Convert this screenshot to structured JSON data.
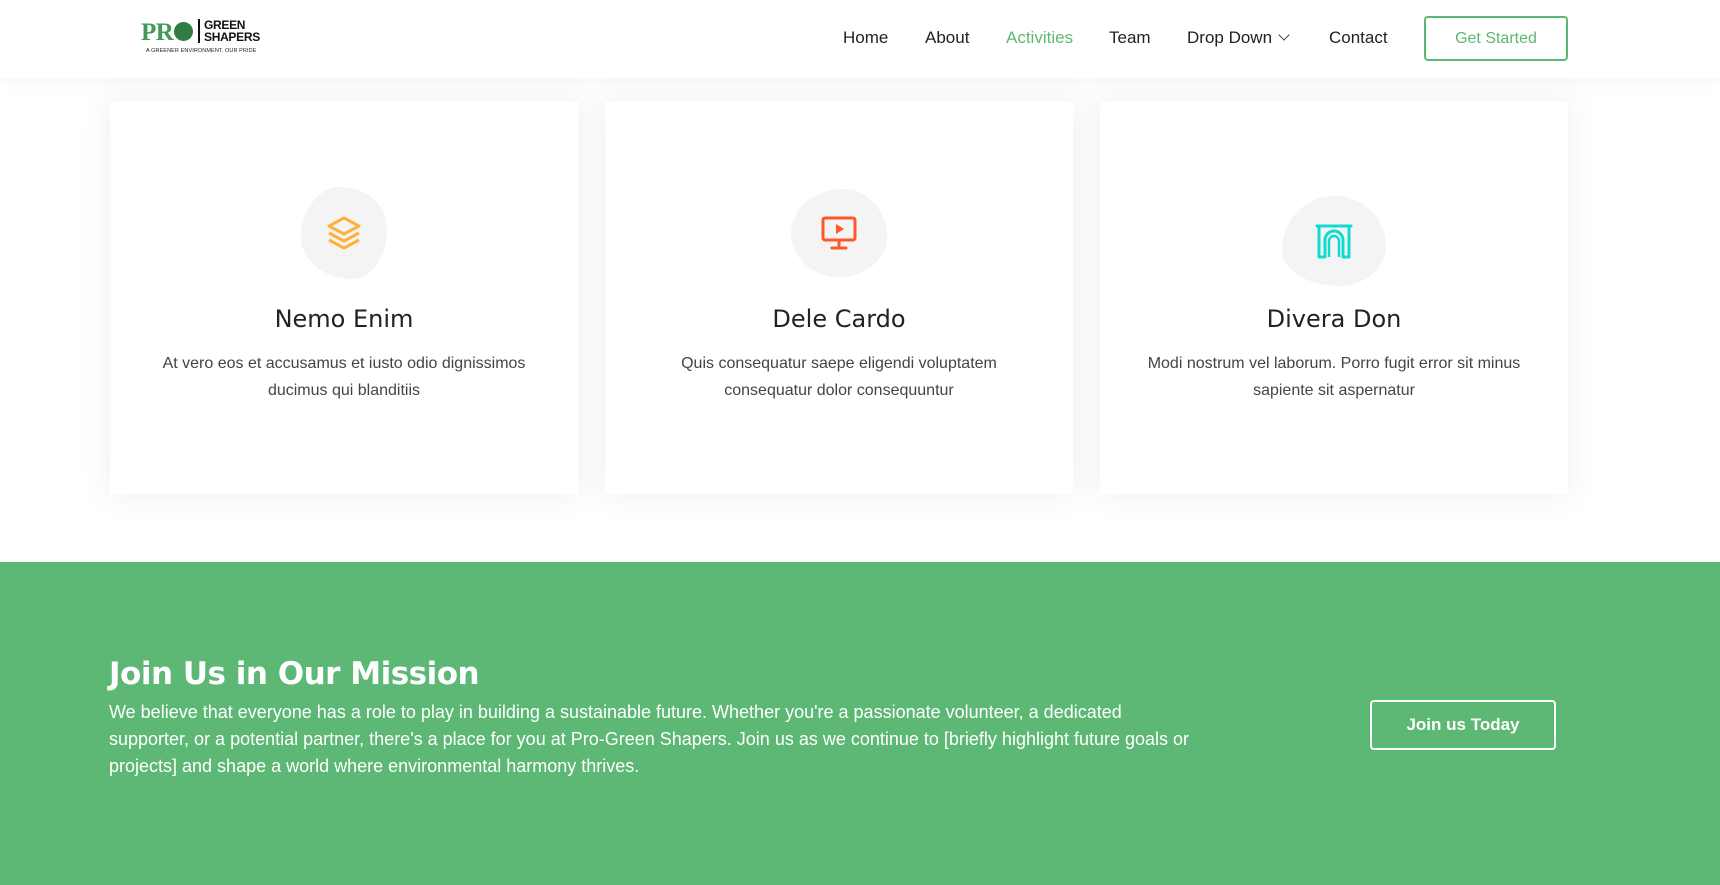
{
  "logo": {
    "pro": "PR",
    "name_line1": "GREEN",
    "name_line2": "SHAPERS",
    "tagline": "A GREENER ENVIRONMENT. OUR PRIDE"
  },
  "nav": {
    "items": [
      {
        "label": "Home",
        "active": false
      },
      {
        "label": "About",
        "active": false
      },
      {
        "label": "Activities",
        "active": true
      },
      {
        "label": "Team",
        "active": false
      },
      {
        "label": "Drop Down",
        "active": false
      },
      {
        "label": "Contact",
        "active": false
      }
    ],
    "cta_label": "Get Started"
  },
  "services": {
    "cards": [
      {
        "icon": "layers-icon",
        "icon_color": "#ffb03b",
        "title": "Nemo Enim",
        "description": "At vero eos et accusamus et iusto odio dignissimos ducimus qui blanditiis"
      },
      {
        "icon": "presentation-icon",
        "icon_color": "#ff5828",
        "title": "Dele Cardo",
        "description": "Quis consequatur saepe eligendi voluptatem consequatur dolor consequuntur"
      },
      {
        "icon": "arch-icon",
        "icon_color": "#11dbcf",
        "title": "Divera Don",
        "description": "Modi nostrum vel laborum. Porro fugit error sit minus sapiente sit aspernatur"
      }
    ]
  },
  "cta": {
    "title": "Join Us in Our Mission",
    "text": "We believe that everyone has a role to play in building a sustainable future. Whether you're a passionate volunteer, a dedicated supporter, or a potential partner, there's a place for you at Pro-Green Shapers. Join us as we continue to [briefly highlight future goals or projects] and shape a world where environmental harmony thrives.",
    "button_label": "Join us Today"
  },
  "colors": {
    "accent": "#5cb874",
    "text_dark": "#222222",
    "text_body": "#444444"
  }
}
